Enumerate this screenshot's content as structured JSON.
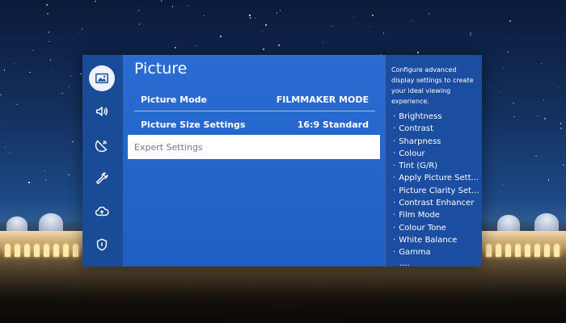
{
  "nav_icons": [
    {
      "name": "picture-icon",
      "selected": true
    },
    {
      "name": "sound-icon",
      "selected": false
    },
    {
      "name": "broadcasting-icon",
      "selected": false
    },
    {
      "name": "wrench-icon",
      "selected": false
    },
    {
      "name": "cloud-upload-icon",
      "selected": false
    },
    {
      "name": "shield-icon",
      "selected": false
    }
  ],
  "page_title": "Picture",
  "menu_rows": [
    {
      "label": "Picture Mode",
      "value": "FILMMAKER MODE"
    },
    {
      "label": "Picture Size Settings",
      "value": "16:9 Standard"
    },
    {
      "label": "Expert Settings",
      "value": ""
    }
  ],
  "info": {
    "description": "Configure advanced display settings to create your ideal viewing experience.",
    "items": [
      "Brightness",
      "Contrast",
      "Sharpness",
      "Colour",
      "Tint (G/R)",
      "Apply Picture Sett...",
      "Picture Clarity Set...",
      "Contrast Enhancer",
      "Film Mode",
      "Colour Tone",
      "White Balance",
      "Gamma"
    ],
    "more": "...."
  },
  "colors": {
    "main_panel": "#2a6cd3",
    "icon_bar": "#1a4b97",
    "info_panel": "#1b4da1",
    "focus_row": "#ffffff"
  }
}
